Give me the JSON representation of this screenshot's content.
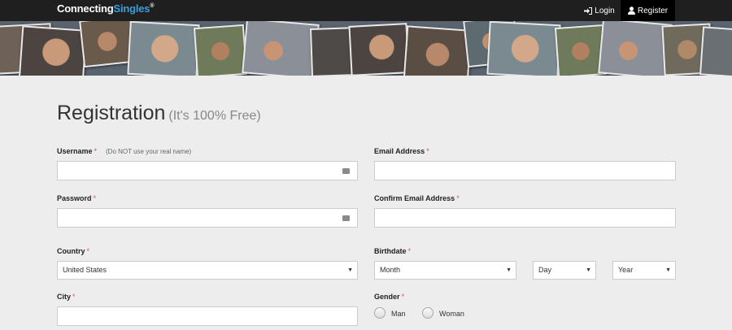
{
  "header": {
    "logo_part1": "Connecting",
    "logo_part2": "Singles",
    "logo_mark": "®",
    "login_label": "Login",
    "register_label": "Register"
  },
  "form": {
    "title": "Registration",
    "subtitle": "(It's 100% Free)",
    "required_mark": "*",
    "username": {
      "label": "Username",
      "hint": "(Do NOT use your real name)",
      "value": ""
    },
    "email": {
      "label": "Email Address",
      "value": ""
    },
    "password": {
      "label": "Password",
      "value": ""
    },
    "confirm_email": {
      "label": "Confirm Email Address",
      "value": ""
    },
    "country": {
      "label": "Country",
      "selected": "United States"
    },
    "birthdate": {
      "label": "Birthdate",
      "month": "Month",
      "day": "Day",
      "year": "Year"
    },
    "city": {
      "label": "City",
      "value": ""
    },
    "gender": {
      "label": "Gender",
      "options": [
        "Man",
        "Woman"
      ]
    }
  },
  "colors": {
    "accent": "#3aa0dc",
    "required": "#d9534f",
    "topbar": "#1f1f1f"
  }
}
